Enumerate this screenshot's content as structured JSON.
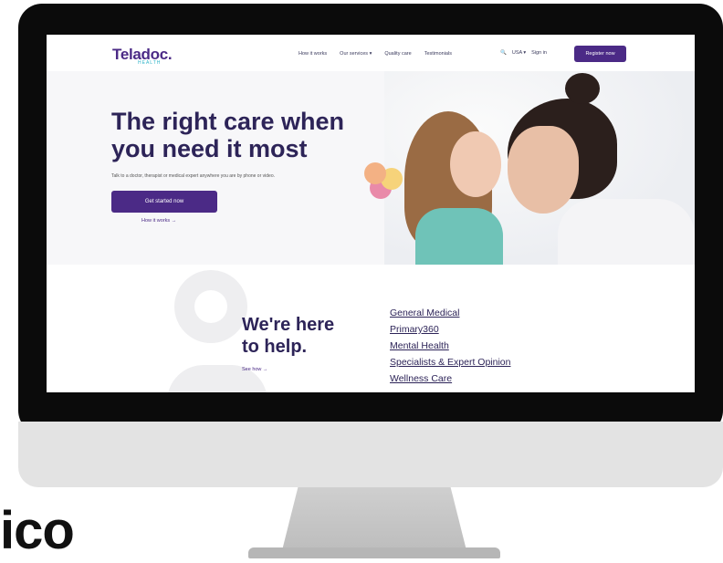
{
  "page": {
    "caption": "ico"
  },
  "nav": {
    "logo": "Teladoc.",
    "logo_sub": "HEALTH",
    "links": [
      "How it works",
      "Our services ▾",
      "Quality care",
      "Testimonials"
    ],
    "search_icon": "🔍",
    "locale": "USA ▾",
    "signin": "Sign in",
    "register": "Register now"
  },
  "hero": {
    "title_line1": "The right care when",
    "title_line2": "you need it most",
    "subtitle": "Talk to a doctor, therapist or medical expert anywhere you are by phone or video.",
    "cta": "Get started now",
    "how_it_works": "How it works →"
  },
  "help": {
    "title_line1": "We're here",
    "title_line2": "to help.",
    "see_how": "See how →",
    "services": [
      "General Medical",
      "Primary360",
      "Mental Health",
      "Specialists & Expert Opinion",
      "Wellness Care"
    ]
  }
}
